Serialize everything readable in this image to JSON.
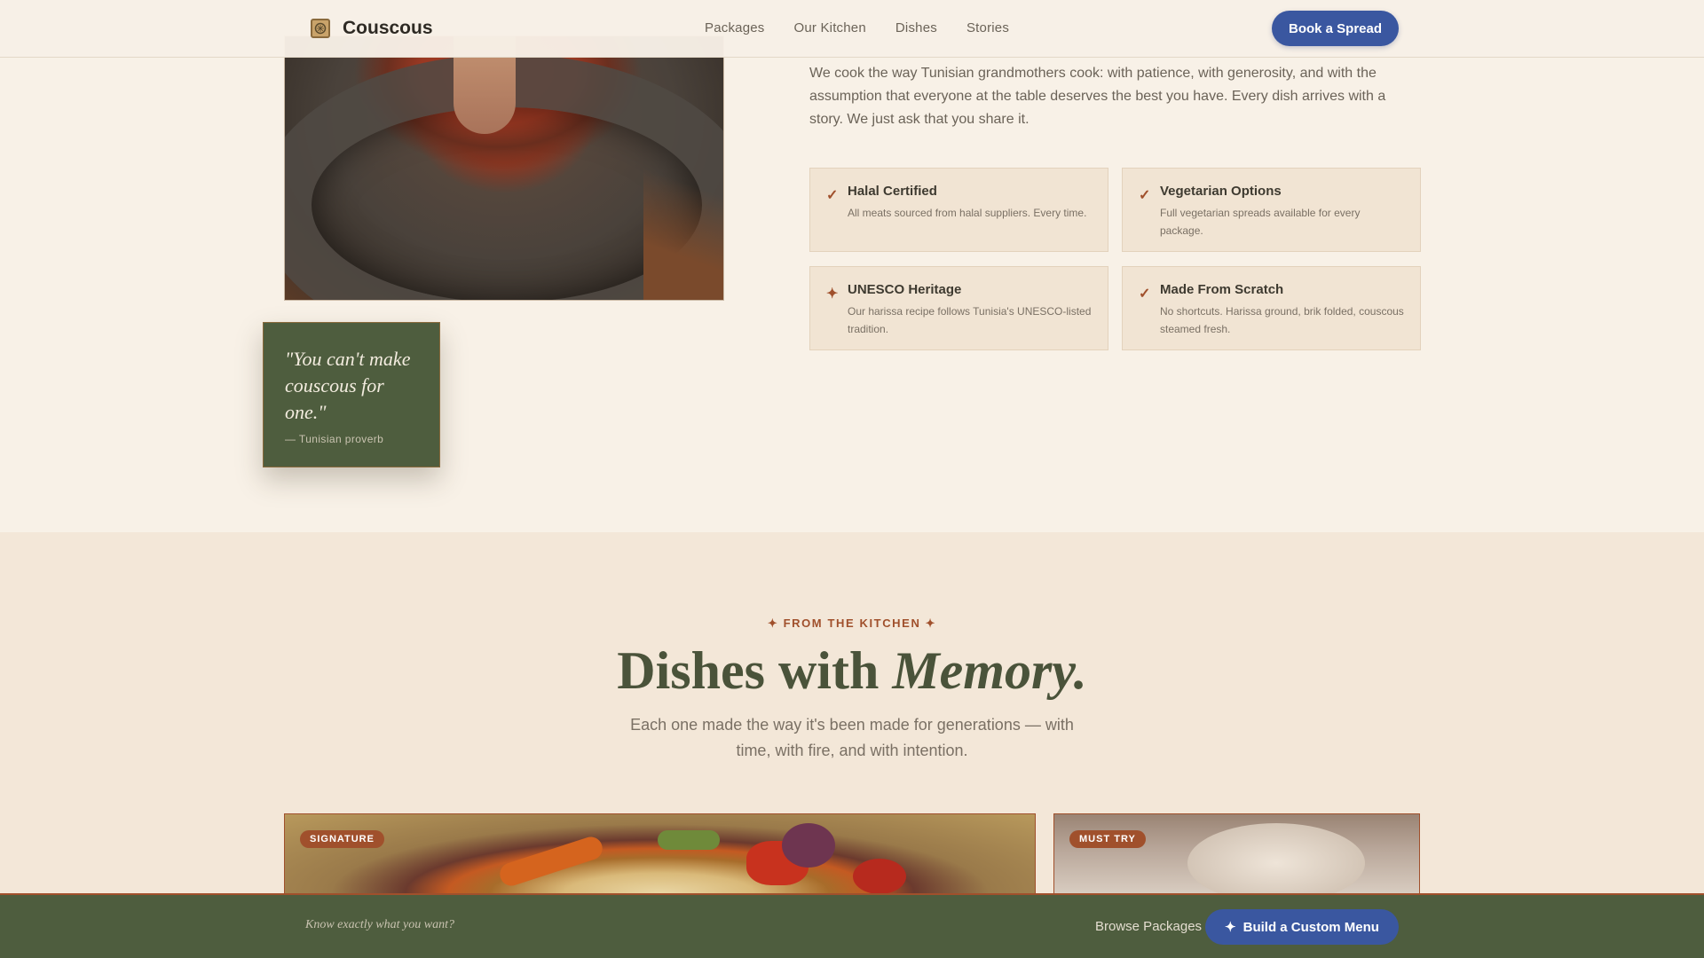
{
  "header": {
    "brand": "Couscous",
    "nav": [
      "Packages",
      "Our Kitchen",
      "Dishes",
      "Stories"
    ],
    "cta": "Book a Spread"
  },
  "about": {
    "intro": "We cook the way Tunisian grandmothers cook: with patience, with generosity, and with the assumption that everyone at the table deserves the best you have. Every dish arrives with a story. We just ask that you share it.",
    "quote": "\"You can't make couscous for one.\"",
    "quote_source": "— Tunisian proverb",
    "features": [
      {
        "icon": "✓",
        "icon_name": "check-icon",
        "title": "Halal Certified",
        "desc": "All meats sourced from halal suppliers. Every time."
      },
      {
        "icon": "✓",
        "icon_name": "check-icon",
        "title": "Vegetarian Options",
        "desc": "Full vegetarian spreads available for every package."
      },
      {
        "icon": "✦",
        "icon_name": "sparkle-icon",
        "title": "UNESCO Heritage",
        "desc": "Our harissa recipe follows Tunisia's UNESCO-listed tradition."
      },
      {
        "icon": "✓",
        "icon_name": "check-icon",
        "title": "Made From Scratch",
        "desc": "No shortcuts. Harissa ground, brik folded, couscous steamed fresh."
      }
    ]
  },
  "dishes": {
    "eyebrow": "✦ FROM THE KITCHEN ✦",
    "title_plain": "Dishes with ",
    "title_em": "Memory.",
    "subtitle": "Each one made the way it's been made for generations — with time, with fire, and with intention.",
    "cards": [
      {
        "badge": "SIGNATURE"
      },
      {
        "badge": "MUST TRY"
      }
    ]
  },
  "bottom_bar": {
    "prompt": "Know exactly what you want?",
    "link": "Browse Packages",
    "cta_icon": "✦",
    "cta": "Build a Custom Menu"
  },
  "colors": {
    "accent_blue": "#3a57a0",
    "olive": "#4e5d3e",
    "terracotta": "#a0502c",
    "cream": "#f8f1e7"
  }
}
